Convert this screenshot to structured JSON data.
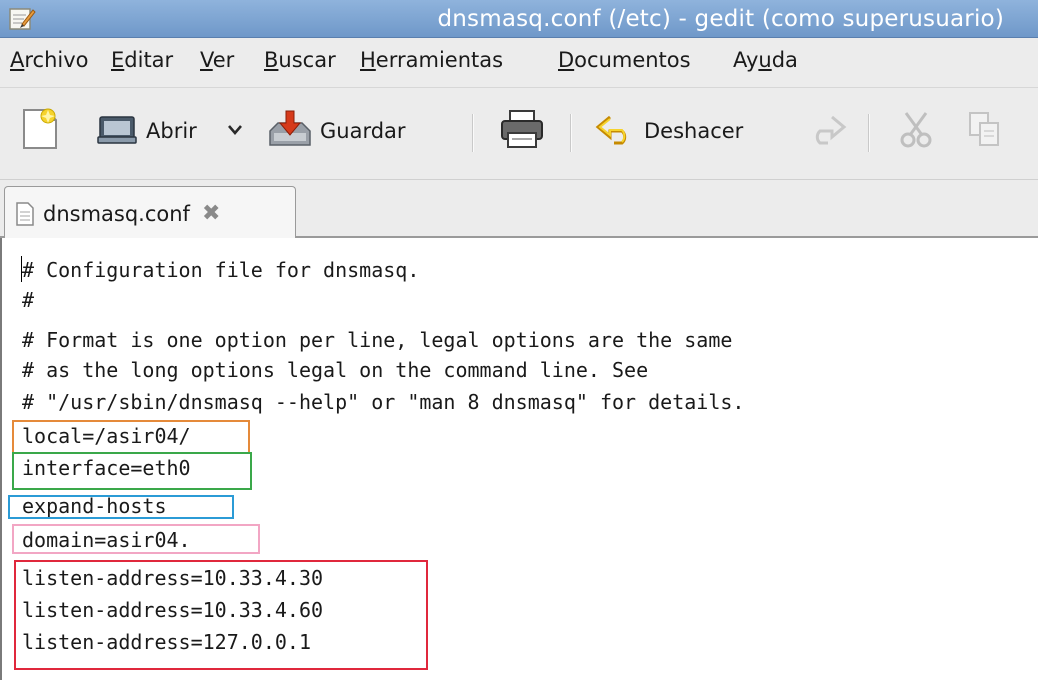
{
  "window": {
    "title": "dnsmasq.conf (/etc) - gedit (como superusuario)"
  },
  "menubar": {
    "items": [
      {
        "label": "Archivo",
        "mnemonic": "A"
      },
      {
        "label": "Editar",
        "mnemonic": "E"
      },
      {
        "label": "Ver",
        "mnemonic": "V"
      },
      {
        "label": "Buscar",
        "mnemonic": "B"
      },
      {
        "label": "Herramientas",
        "mnemonic": "H"
      },
      {
        "label": "Documentos",
        "mnemonic": "D"
      },
      {
        "label": "Ayuda",
        "mnemonic": "u"
      }
    ]
  },
  "toolbar": {
    "open_label": "Abrir",
    "save_label": "Guardar",
    "undo_label": "Deshacer",
    "icons": [
      "new-document-icon",
      "open-folder-icon",
      "chevron-down-icon",
      "save-icon",
      "print-icon",
      "undo-icon",
      "redo-icon",
      "cut-icon",
      "copy-icon"
    ]
  },
  "tab": {
    "label": "dnsmasq.conf",
    "close_glyph": "✖"
  },
  "editor": {
    "lines": [
      "# Configuration file for dnsmasq.",
      "#",
      "# Format is one option per line, legal options are the same",
      "# as the long options legal on the command line. See",
      "# \"/usr/sbin/dnsmasq --help\" or \"man 8 dnsmasq\" for details.",
      "local=/asir04/",
      "interface=eth0",
      "expand-hosts",
      "domain=asir04.",
      "listen-address=10.33.4.30",
      "listen-address=10.33.4.60",
      "listen-address=127.0.0.1"
    ],
    "highlights": [
      {
        "name": "highlight-local",
        "color": "#e58a3a"
      },
      {
        "name": "highlight-interface",
        "color": "#3aa84a"
      },
      {
        "name": "highlight-expand-hosts",
        "color": "#2b9bd6"
      },
      {
        "name": "highlight-domain",
        "color": "#f2a6c4"
      },
      {
        "name": "highlight-listen-address",
        "color": "#e0283c"
      }
    ]
  },
  "colors": {
    "titlebar": "#7aa3d3",
    "chrome": "#ececec"
  }
}
